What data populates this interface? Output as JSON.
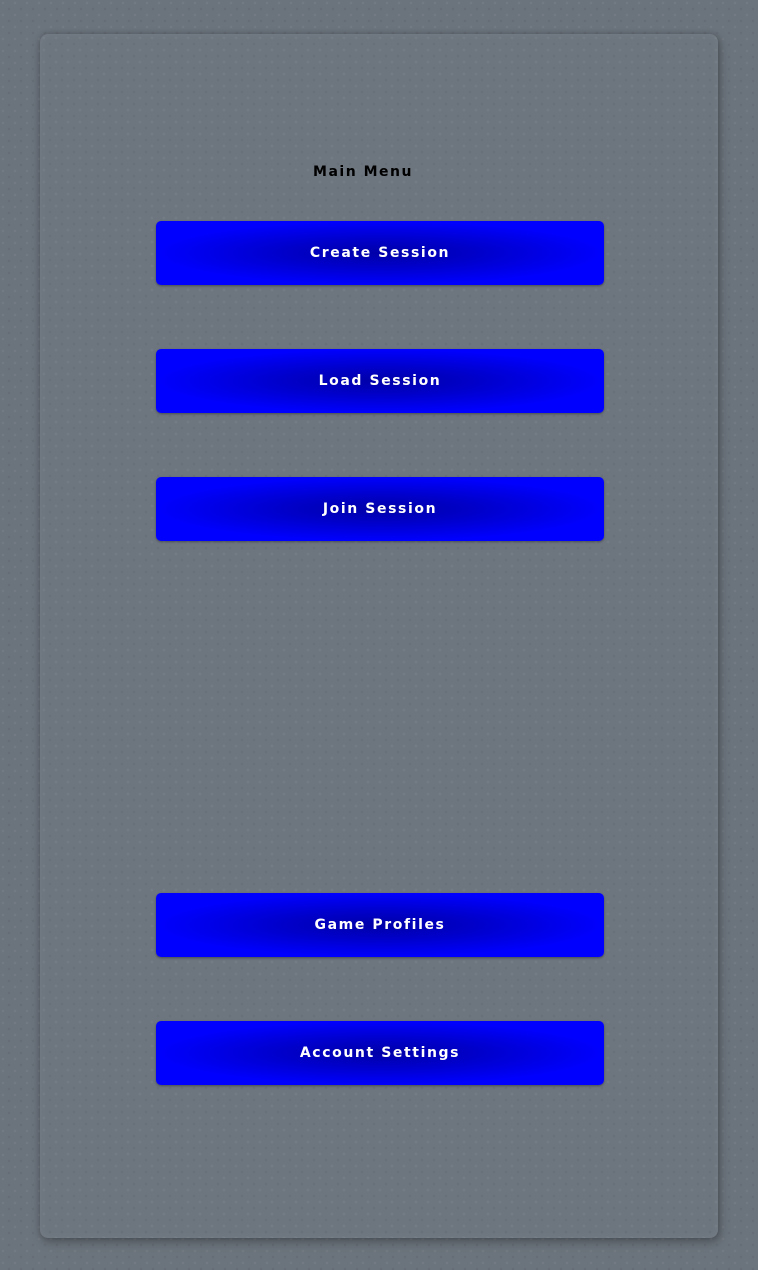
{
  "main_menu": {
    "title": "Main Menu",
    "buttons": [
      {
        "label": "Create Session"
      },
      {
        "label": "Load Session"
      },
      {
        "label": "Join Session"
      },
      {
        "label": "Game Profiles"
      },
      {
        "label": "Account Settings"
      }
    ]
  },
  "colors": {
    "background": "#6b737c",
    "button": "#0000ff",
    "button_center": "#0000a8",
    "button_text": "#ffffff",
    "title_text": "#000000"
  }
}
